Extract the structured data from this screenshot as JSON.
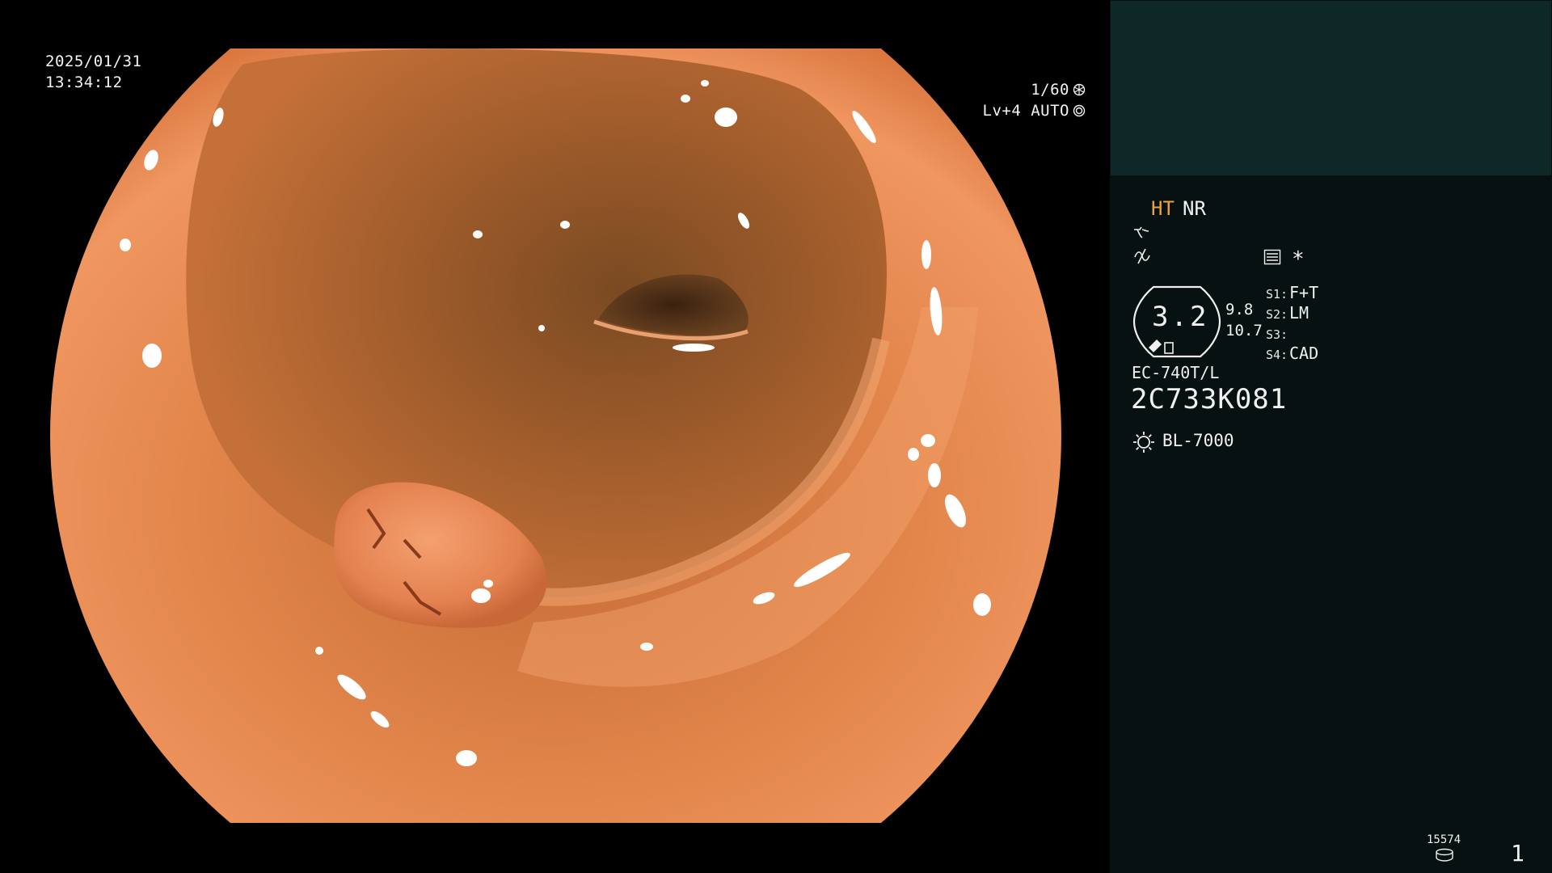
{
  "osd": {
    "date": "2025/01/31",
    "time": "13:34:12",
    "shutter": "1/60",
    "shutter_icon": "aperture-icon",
    "iris_mode": "Lv+4 AUTO",
    "iris_icon": "iris-icon"
  },
  "panel": {
    "mode_ht": "HT",
    "mode_nr": "NR",
    "ht_color": "#f0a23a",
    "icons": [
      "structure-wave-icon",
      "color-wave-icon",
      "menu-icon"
    ],
    "star": "*",
    "zoom_value": "3.2",
    "value_a": "9.8",
    "value_b": "10.7",
    "switches": [
      {
        "code": "S1:",
        "value": "F+T"
      },
      {
        "code": "S2:",
        "value": "LM"
      },
      {
        "code": "S3:",
        "value": ""
      },
      {
        "code": "S4:",
        "value": "CAD"
      }
    ],
    "scope_model": "EC-740T/L",
    "scope_serial": "2C733K081",
    "light_icon": "light-source-icon",
    "light_source": "BL-7000",
    "storage_count": "15574",
    "storage_icon": "storage-disk-icon",
    "page_number": "1"
  },
  "colors": {
    "background": "#000000",
    "panel": "#071111",
    "panel_top": "#0e2727",
    "tissue": "#e0824a"
  }
}
